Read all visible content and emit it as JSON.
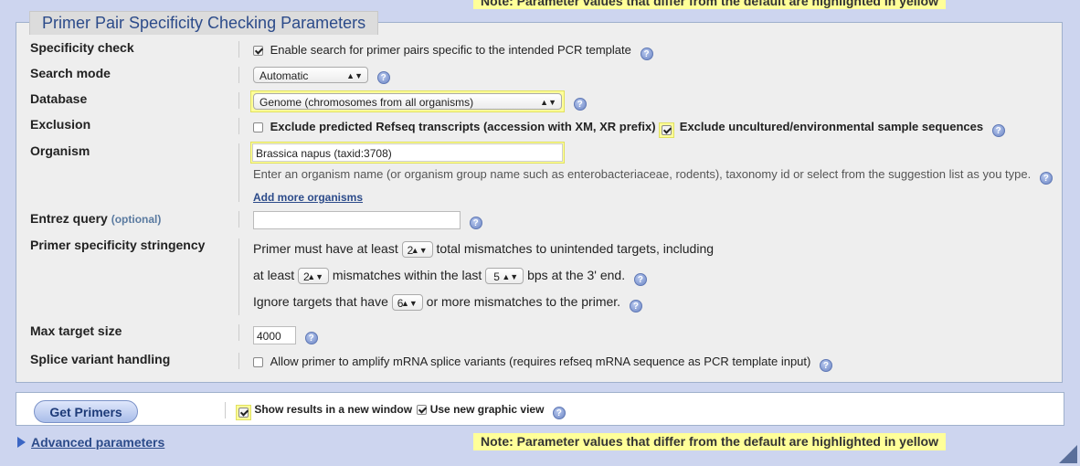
{
  "top_note": "Note: Parameter values that differ from the default are highlighted in yellow",
  "section_title": "Primer Pair Specificity Checking Parameters",
  "specificity": {
    "label": "Specificity check",
    "checkbox_label": "Enable search for primer pairs specific to the intended PCR template",
    "checked": true
  },
  "search_mode": {
    "label": "Search mode",
    "selected": "Automatic"
  },
  "database": {
    "label": "Database",
    "selected": "Genome (chromosomes from all organisms)"
  },
  "exclusion": {
    "label": "Exclusion",
    "opt1": "Exclude predicted Refseq transcripts (accession with XM, XR prefix)",
    "opt2": "Exclude uncultured/environmental sample sequences"
  },
  "organism": {
    "label": "Organism",
    "value": "Brassica napus (taxid:3708)",
    "hint": "Enter an organism name (or organism group name such as enterobacteriaceae, rodents), taxonomy id or select from the suggestion list as you type.",
    "add_more": "Add more organisms"
  },
  "entrez": {
    "label": "Entrez query",
    "optional": "(optional)",
    "value": ""
  },
  "stringency": {
    "label": "Primer specificity stringency",
    "line1_pre": "Primer must have at least",
    "total_mismatches": "2",
    "line1_post": "total mismatches to unintended targets, including",
    "line2_pre": "at least",
    "mismatches_3prime": "2",
    "line2_mid": "mismatches within the last",
    "last_bps": "5",
    "line2_post": "bps at the 3' end.",
    "line3_pre": "Ignore targets that have",
    "ignore_mismatches": "6",
    "line3_post": "or more mismatches to the primer."
  },
  "max_target": {
    "label": "Max target size",
    "value": "4000"
  },
  "splice": {
    "label": "Splice variant handling",
    "checkbox_label": "Allow primer to amplify mRNA splice variants (requires refseq mRNA sequence as PCR template input)"
  },
  "bottom": {
    "button": "Get Primers",
    "new_window": "Show results in a new window",
    "graphic_view": "Use new graphic view"
  },
  "advanced": "Advanced parameters",
  "bottom_note": "Note: Parameter values that differ from the default are highlighted in yellow",
  "colors": {
    "highlight": "#ffff99",
    "page_bg": "#cdd5ef",
    "link": "#2c4b8a"
  }
}
